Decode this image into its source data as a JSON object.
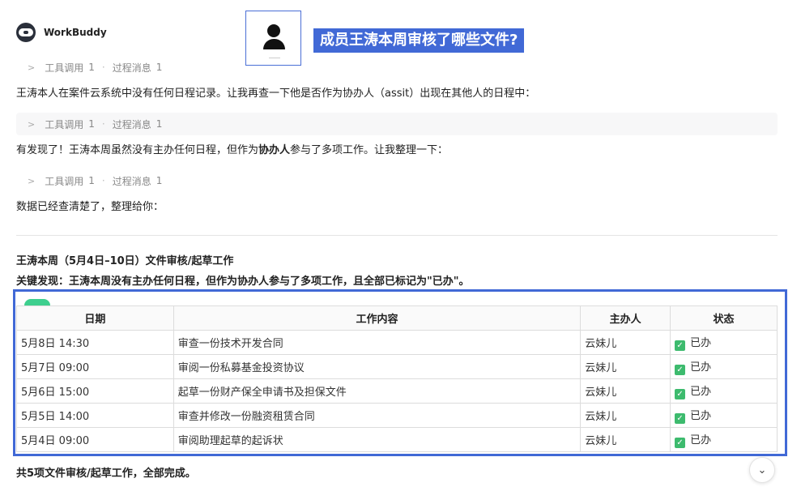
{
  "app": {
    "name": "WorkBuddy"
  },
  "question": "成员王涛本周审核了哪些文件?",
  "tool_rows": [
    {
      "tool_label": "工具调用",
      "tool_count": "1",
      "process_label": "过程消息",
      "process_count": "1"
    },
    {
      "tool_label": "工具调用",
      "tool_count": "1",
      "process_label": "过程消息",
      "process_count": "1"
    },
    {
      "tool_label": "工具调用",
      "tool_count": "1",
      "process_label": "过程消息",
      "process_count": "1"
    }
  ],
  "messages": {
    "m1": "王涛本人在案件云系统中没有任何日程记录。让我再查一下他是否作为协办人（assit）出现在其他人的日程中：",
    "m2_pre": "有发现了！王涛本周虽然没有主办任何日程，但作为",
    "m2_bold": "协办人",
    "m2_post": "参与了多项工作。让我整理一下：",
    "m3": "数据已经查清楚了，整理给你："
  },
  "report": {
    "title": "王涛本周（5月4日–10日）文件审核/起草工作",
    "key_finding": "关键发现：王涛本周没有主办任何日程，但作为协办人参与了多项工作，且全部已标记为\"已办\"。",
    "summary": "共5项文件审核/起草工作，全部完成。"
  },
  "table": {
    "headers": {
      "date": "日期",
      "content": "工作内容",
      "host": "主办人",
      "status": "状态"
    },
    "rows": [
      {
        "date": "5月8日 14:30",
        "content": "审查一份技术开发合同",
        "host": "云妹儿",
        "status": "已办"
      },
      {
        "date": "5月7日 09:00",
        "content": "审阅一份私募基金投资协议",
        "host": "云妹儿",
        "status": "已办"
      },
      {
        "date": "5月6日 15:00",
        "content": "起草一份财产保全申请书及担保文件",
        "host": "云妹儿",
        "status": "已办"
      },
      {
        "date": "5月5日 14:00",
        "content": "审查并修改一份融资租赁合同",
        "host": "云妹儿",
        "status": "已办"
      },
      {
        "date": "5月4日 09:00",
        "content": "审阅助理起草的起诉状",
        "host": "云妹儿",
        "status": "已办"
      }
    ]
  },
  "colors": {
    "accent": "#4169d6",
    "done": "#3dbb6e"
  },
  "icons": {
    "scroll": "chevron-down-icon",
    "status": "checkbox-checked-icon"
  }
}
